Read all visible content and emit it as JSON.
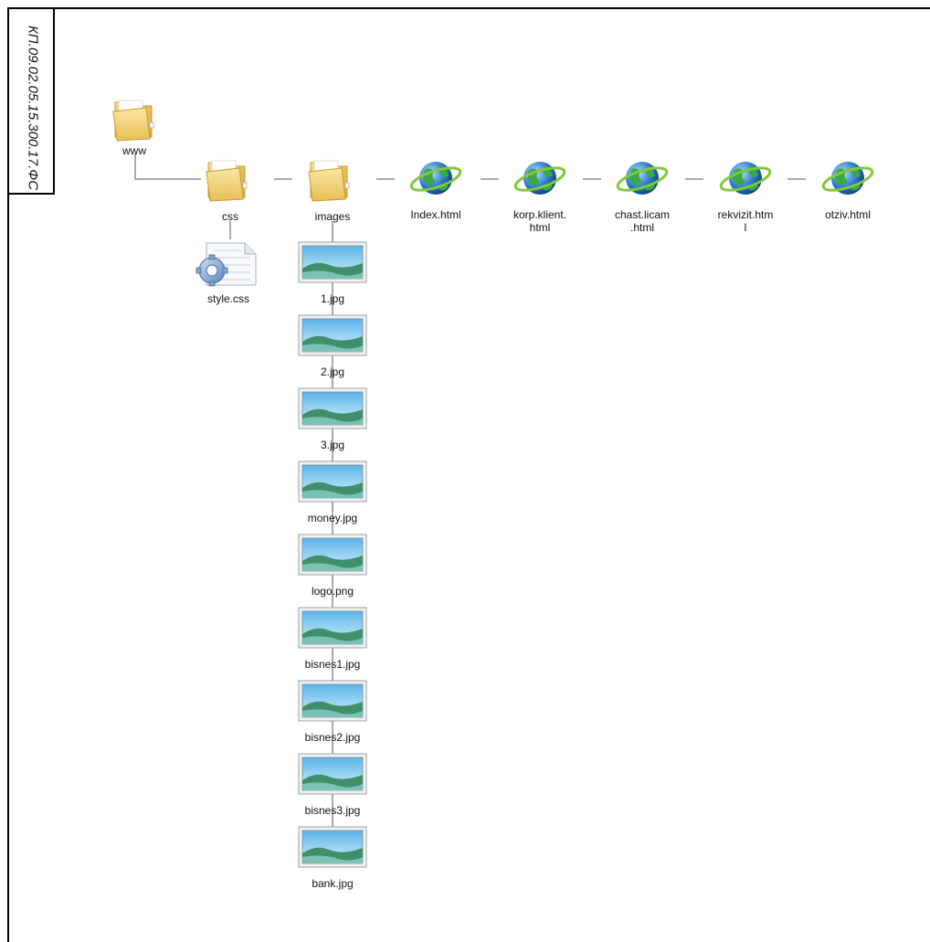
{
  "stamp": {
    "code": "КП.09.02.05.15.300.17.ФС"
  },
  "root": {
    "label": "www"
  },
  "folders": {
    "css": {
      "label": "css"
    },
    "images": {
      "label": "images"
    }
  },
  "css_files": [
    {
      "label": "style.css"
    }
  ],
  "html_files": [
    {
      "label": "Index.html"
    },
    {
      "label": "korp.klient.\nhtml"
    },
    {
      "label": "chast.licam\n.html"
    },
    {
      "label": "rekvizit.htm\nl"
    },
    {
      "label": "otziv.html"
    }
  ],
  "image_files": [
    {
      "label": "1.jpg"
    },
    {
      "label": "2.jpg"
    },
    {
      "label": "3.jpg"
    },
    {
      "label": "money.jpg"
    },
    {
      "label": "logo.png"
    },
    {
      "label": "bisnes1.jpg"
    },
    {
      "label": "bisnes2.jpg"
    },
    {
      "label": "bisnes3.jpg"
    },
    {
      "label": "bank.jpg"
    }
  ],
  "icons": {
    "folder": "folder-icon",
    "browser": "browser-globe-icon",
    "stylesheet": "stylesheet-file-icon",
    "image": "image-file-icon"
  }
}
